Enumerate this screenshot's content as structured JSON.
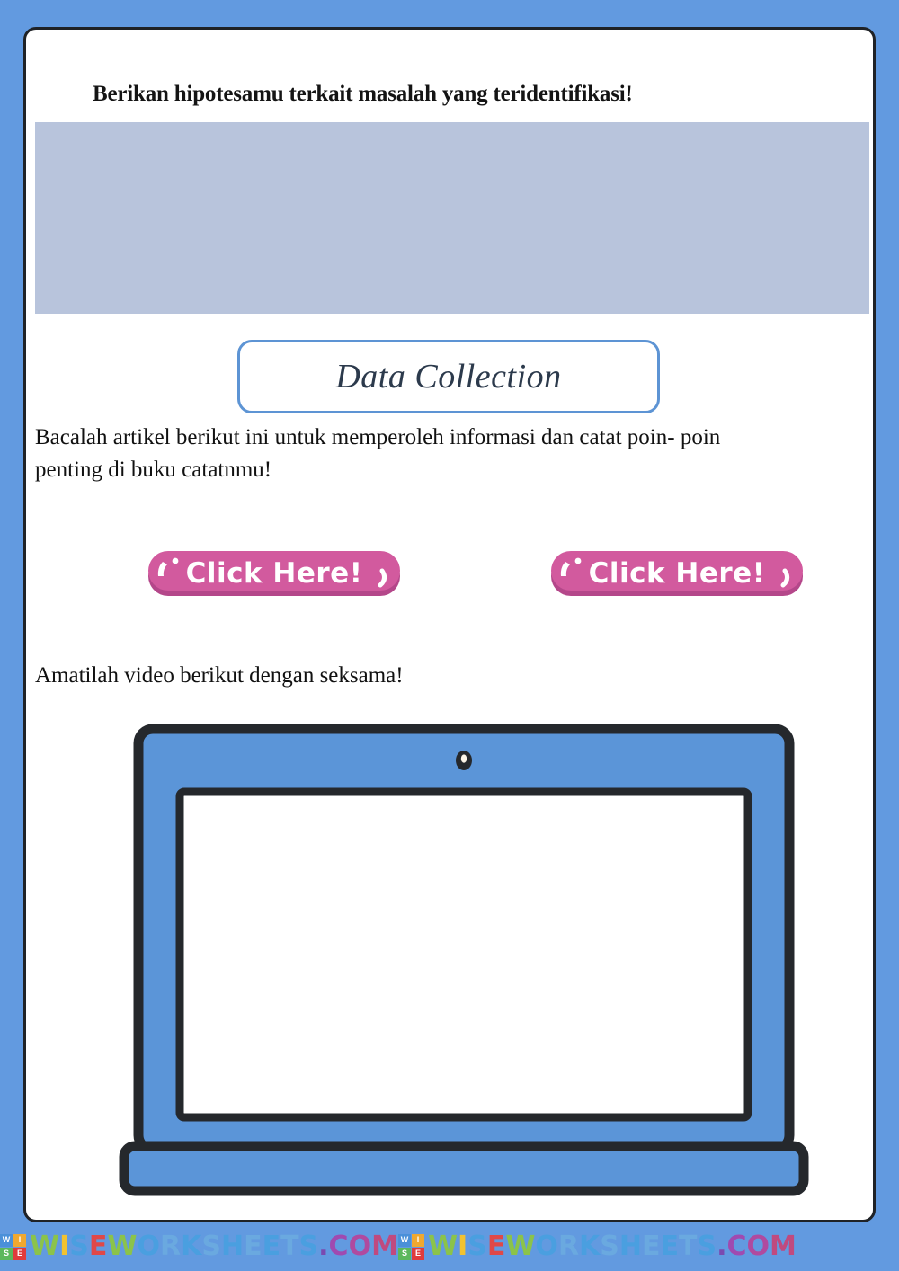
{
  "page": {
    "background_color": "#629ae0",
    "card_background": "#ffffff",
    "card_border_color": "#1f2226"
  },
  "prompt": {
    "heading": "Berikan hipotesamu terkait masalah yang teridentifikasi!",
    "answer_box_color": "#b8c4dc",
    "answer_box_value": ""
  },
  "section": {
    "title": "Data Collection",
    "border_color": "#5d94d4",
    "text_color": "#2c3a4c"
  },
  "instruction": {
    "line1": "Bacalah artikel berikut ini   untuk memperoleh informasi dan catat poin- poin",
    "line2": "penting di buku catatnmu!"
  },
  "buttons": [
    {
      "label": "Click Here!",
      "fill_color": "#d25a9e",
      "shadow_color": "#b4478a",
      "text_color": "#ffffff"
    },
    {
      "label": "Click Here!",
      "fill_color": "#d25a9e",
      "shadow_color": "#b4478a",
      "text_color": "#ffffff"
    }
  ],
  "video": {
    "instruction": "Amatilah video berikut dengan seksama!",
    "laptop": {
      "bezel_color": "#5b95d8",
      "outline_color": "#25282c",
      "screen_color": "#ffffff",
      "webcam_color": "#25282c"
    }
  },
  "footer": {
    "watermarks": [
      {
        "logo_letters": [
          "W",
          "I",
          "S",
          "E"
        ],
        "text": "WISEWORKSHEETS.COM"
      },
      {
        "logo_letters": [
          "W",
          "I",
          "S",
          "E"
        ],
        "text": "WISEWORKSHEETS.COM"
      }
    ],
    "letter_colors": [
      "#8bc34a",
      "#f2c230",
      "#4a9fe0",
      "#e04848",
      "#8bc34a",
      "#4a9fe0",
      "#6aa9e0",
      "#4a9fe0",
      "#6aa9e0",
      "#4a9fe0",
      "#6aa9e0",
      "#4a9fe0",
      "#6aa9e0",
      "#4a9fe0",
      "#7a4ab0",
      "#a04ab0",
      "#b04a9f",
      "#c04a7f"
    ]
  }
}
